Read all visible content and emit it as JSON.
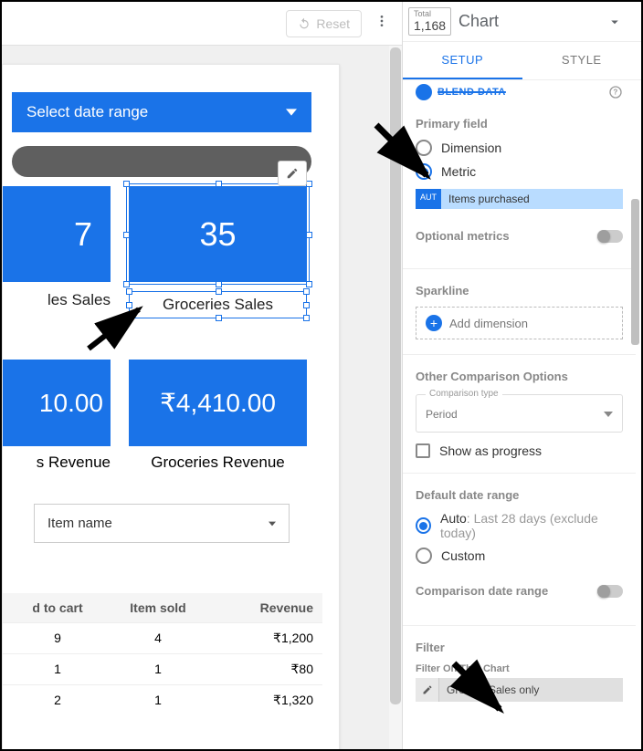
{
  "topbar": {
    "reset": "Reset"
  },
  "report": {
    "date_select": "Select date range",
    "card1_value": "7",
    "card2_value": "35",
    "card1_label": "les Sales",
    "card2_label": "Groceries Sales",
    "rev1_value": "10.00",
    "rev2_value": "₹4,410.00",
    "rev1_label": "s Revenue",
    "rev2_label": "Groceries Revenue",
    "item_dropdown": "Item name",
    "table": {
      "headers": [
        "d to cart",
        "Item sold",
        "Revenue"
      ],
      "rows": [
        [
          "9",
          "4",
          "₹1,200"
        ],
        [
          "1",
          "1",
          "₹80"
        ],
        [
          "2",
          "1",
          "₹1,320"
        ]
      ]
    }
  },
  "side": {
    "thumb_label": "Total",
    "thumb_value": "1,168",
    "title": "Chart",
    "tabs": {
      "setup": "SETUP",
      "style": "STYLE"
    },
    "blend": "BLEND DATA",
    "primary_field": "Primary field",
    "dimension": "Dimension",
    "metric": "Metric",
    "field_tag": "AUT",
    "field_name": "Items purchased",
    "optional_metrics": "Optional metrics",
    "sparkline": "Sparkline",
    "add_dimension": "Add dimension",
    "other_cmp": "Other Comparison Options",
    "cmp_type_legend": "Comparison type",
    "cmp_type_value": "Period",
    "show_progress": "Show as progress",
    "default_dr": "Default date range",
    "auto_label": "Auto",
    "auto_hint": ": Last 28 days (exclude today)",
    "custom": "Custom",
    "cmp_dr": "Comparison date range",
    "filter": "Filter",
    "filter_on": "Filter On This Chart",
    "filter_chip": "Grocery Sales only"
  }
}
